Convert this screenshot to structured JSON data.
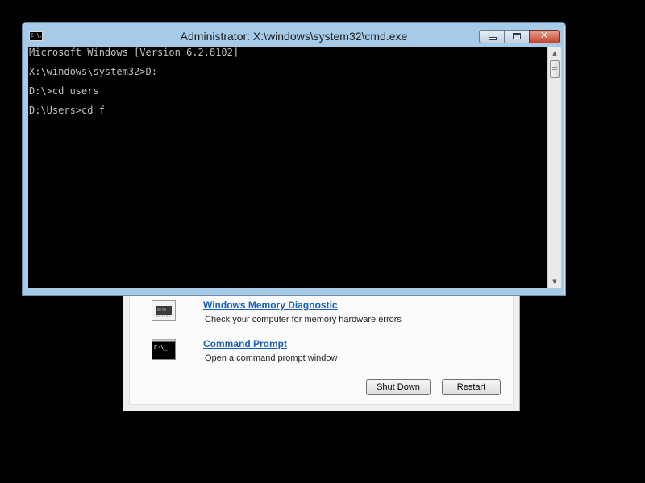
{
  "window": {
    "title": "Administrator: X:\\windows\\system32\\cmd.exe",
    "icon": "cmd-window-icon",
    "icon_text": "C:\\."
  },
  "console": {
    "lines": [
      "Microsoft Windows [Version 6.2.8102]",
      "",
      "X:\\windows\\system32>D:",
      "",
      "D:\\>cd users",
      "",
      "D:\\Users>cd f"
    ],
    "background_color": "#000000",
    "text_color": "#c0c0c0"
  },
  "recovery": {
    "options": [
      {
        "title": "Windows Memory Diagnostic",
        "description": "Check your computer for memory hardware errors",
        "icon": "memory-chip-icon"
      },
      {
        "title": "Command Prompt",
        "description": "Open a command prompt window",
        "icon": "command-prompt-icon",
        "icon_text": "C:\\_"
      }
    ],
    "buttons": {
      "shutdown_label": "Shut Down",
      "restart_label": "Restart"
    },
    "link_color": "#1a5fb4"
  }
}
